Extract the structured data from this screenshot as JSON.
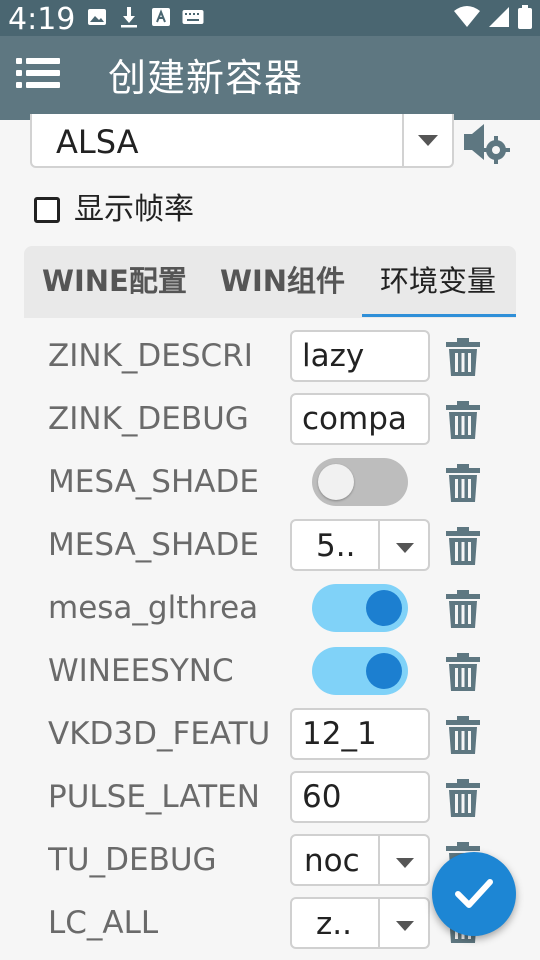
{
  "status_bar": {
    "time": "4:19",
    "icons": [
      "image-icon",
      "download-icon",
      "a-icon",
      "keyboard-icon",
      "wifi-icon",
      "signal-icon",
      "battery-icon"
    ]
  },
  "app_bar": {
    "title": "创建新容器",
    "menu_icon": "hamburger-menu-icon"
  },
  "audio_driver": {
    "value": "ALSA"
  },
  "show_fps": {
    "label": "显示帧率",
    "checked": false
  },
  "tabs": [
    {
      "label": "WINE配置",
      "active": false
    },
    {
      "label": "WIN组件",
      "active": false
    },
    {
      "label": "环境变量",
      "active": true
    }
  ],
  "env_vars": [
    {
      "name": "ZINK_DESCRI",
      "type": "text",
      "value": "lazy"
    },
    {
      "name": "ZINK_DEBUG",
      "type": "text",
      "value": "compa"
    },
    {
      "name": "MESA_SHADE",
      "type": "toggle",
      "on": false
    },
    {
      "name": "MESA_SHADE",
      "type": "select",
      "value": "5.."
    },
    {
      "name": "mesa_glthrea",
      "type": "toggle",
      "on": true
    },
    {
      "name": "WINEESYNC",
      "type": "toggle",
      "on": true
    },
    {
      "name": "VKD3D_FEATU",
      "type": "text",
      "value": "12_1"
    },
    {
      "name": "PULSE_LATEN",
      "type": "text",
      "value": "60"
    },
    {
      "name": "TU_DEBUG",
      "type": "select",
      "value": "noc"
    },
    {
      "name": "LC_ALL",
      "type": "select",
      "value": "z.."
    }
  ],
  "colors": {
    "status_bar": "#4a6671",
    "app_bar": "#5e7781",
    "accent": "#1d86d4",
    "toggle_on_track": "#80d2f8",
    "toggle_on_knob": "#1c7fd0"
  },
  "fab": {
    "icon": "checkmark-icon"
  }
}
